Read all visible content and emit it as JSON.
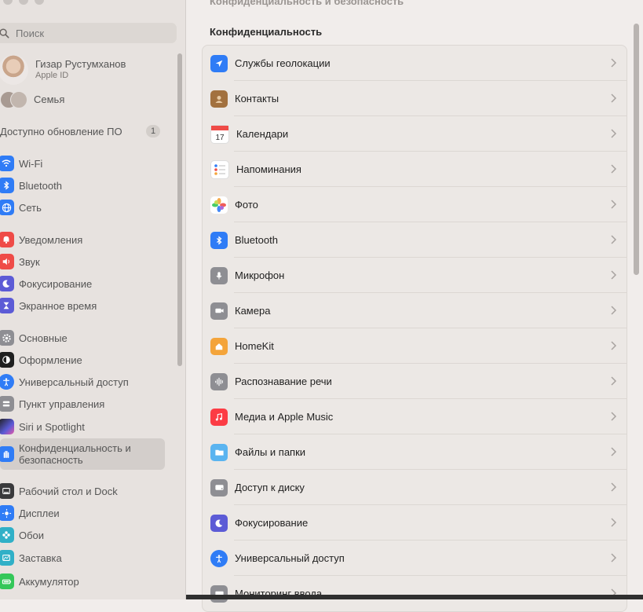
{
  "window": {
    "pane_title": "Конфиденциальность и безопасность"
  },
  "search": {
    "placeholder": "Поиск"
  },
  "user": {
    "name": "Гизар Рустумханов",
    "subtitle": "Apple ID"
  },
  "family": {
    "label": "Семья"
  },
  "update": {
    "label": "Доступно обновление ПО",
    "count": "1"
  },
  "sidebar": {
    "items": [
      {
        "label": "Wi‑Fi",
        "icon": "wifi-icon",
        "color": "#2f7cf6"
      },
      {
        "label": "Bluetooth",
        "icon": "bluetooth-icon",
        "color": "#2f7cf6"
      },
      {
        "label": "Сеть",
        "icon": "globe-icon",
        "color": "#2f7cf6"
      },
      {
        "label": "Уведомления",
        "icon": "bell-icon",
        "color": "#ef4b47"
      },
      {
        "label": "Звук",
        "icon": "speaker-icon",
        "color": "#ef4b47"
      },
      {
        "label": "Фокусирование",
        "icon": "moon-icon",
        "color": "#5c5bd6"
      },
      {
        "label": "Экранное время",
        "icon": "hourglass-icon",
        "color": "#5c5bd6"
      },
      {
        "label": "Основные",
        "icon": "gear-icon",
        "color": "#8e8e93"
      },
      {
        "label": "Оформление",
        "icon": "appearance-icon",
        "color": "#1f1f1f"
      },
      {
        "label": "Универсальный доступ",
        "icon": "accessibility-icon",
        "color": "#2f7cf6"
      },
      {
        "label": "Пункт управления",
        "icon": "control-center-icon",
        "color": "#8e8e93"
      },
      {
        "label": "Siri и Spotlight",
        "icon": "siri-icon",
        "color": "#3a3a3c"
      },
      {
        "label": "Конфиденциальность и безопасность",
        "icon": "hand-icon",
        "color": "#2f7cf6"
      },
      {
        "label": "Рабочий стол и Dock",
        "icon": "desktop-icon",
        "color": "#3a3a3c"
      },
      {
        "label": "Дисплеи",
        "icon": "sun-icon",
        "color": "#2f7cf6"
      },
      {
        "label": "Обои",
        "icon": "flower-icon",
        "color": "#30b0c7"
      },
      {
        "label": "Заставка",
        "icon": "screensaver-icon",
        "color": "#30b0c7"
      },
      {
        "label": "Аккумулятор",
        "icon": "battery-icon",
        "color": "#34c759"
      }
    ]
  },
  "main": {
    "section_title": "Конфиденциальность",
    "rows": [
      {
        "label": "Службы геолокации",
        "icon": "location-arrow-icon",
        "color": "#2f7cf6"
      },
      {
        "label": "Контакты",
        "icon": "contacts-icon",
        "color": "#a2713f"
      },
      {
        "label": "Календари",
        "icon": "calendar-icon",
        "color": "#ffffff"
      },
      {
        "label": "Напоминания",
        "icon": "reminders-icon",
        "color": "#ffffff"
      },
      {
        "label": "Фото",
        "icon": "photos-icon",
        "color": "#ffffff"
      },
      {
        "label": "Bluetooth",
        "icon": "bluetooth-icon",
        "color": "#2f7cf6"
      },
      {
        "label": "Микрофон",
        "icon": "microphone-icon",
        "color": "#8e8e93"
      },
      {
        "label": "Камера",
        "icon": "camera-icon",
        "color": "#8e8e93"
      },
      {
        "label": "HomeKit",
        "icon": "home-icon",
        "color": "#f4a43a"
      },
      {
        "label": "Распознавание речи",
        "icon": "waveform-icon",
        "color": "#8e8e93"
      },
      {
        "label": "Медиа и Apple Music",
        "icon": "music-note-icon",
        "color": "#fc3c44"
      },
      {
        "label": "Файлы и папки",
        "icon": "folder-icon",
        "color": "#5ab4f0"
      },
      {
        "label": "Доступ к диску",
        "icon": "disk-icon",
        "color": "#8e8e93"
      },
      {
        "label": "Фокусирование",
        "icon": "moon-icon",
        "color": "#5c5bd6"
      },
      {
        "label": "Универсальный доступ",
        "icon": "accessibility-icon",
        "color": "#2f7cf6"
      },
      {
        "label": "Мониторинг ввода",
        "icon": "keyboard-icon",
        "color": "#8e8e93"
      }
    ]
  }
}
